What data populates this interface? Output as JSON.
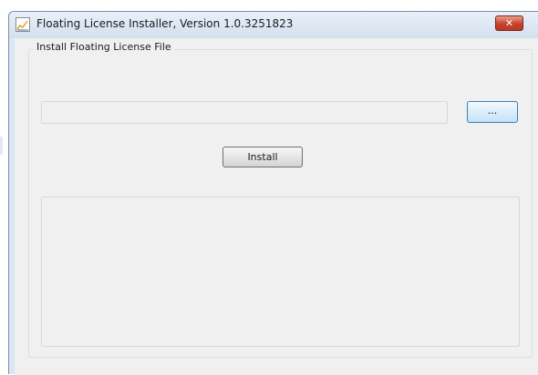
{
  "window": {
    "title": "Floating License Installer, Version 1.0.3251823",
    "close_label": "✕"
  },
  "group": {
    "label": "Install Floating License File"
  },
  "license_file": {
    "value": "",
    "placeholder": ""
  },
  "buttons": {
    "browse_label": "...",
    "install_label": "Install"
  },
  "output": {
    "text": ""
  },
  "icons": {
    "app": "chart-icon",
    "close": "close-icon"
  }
}
